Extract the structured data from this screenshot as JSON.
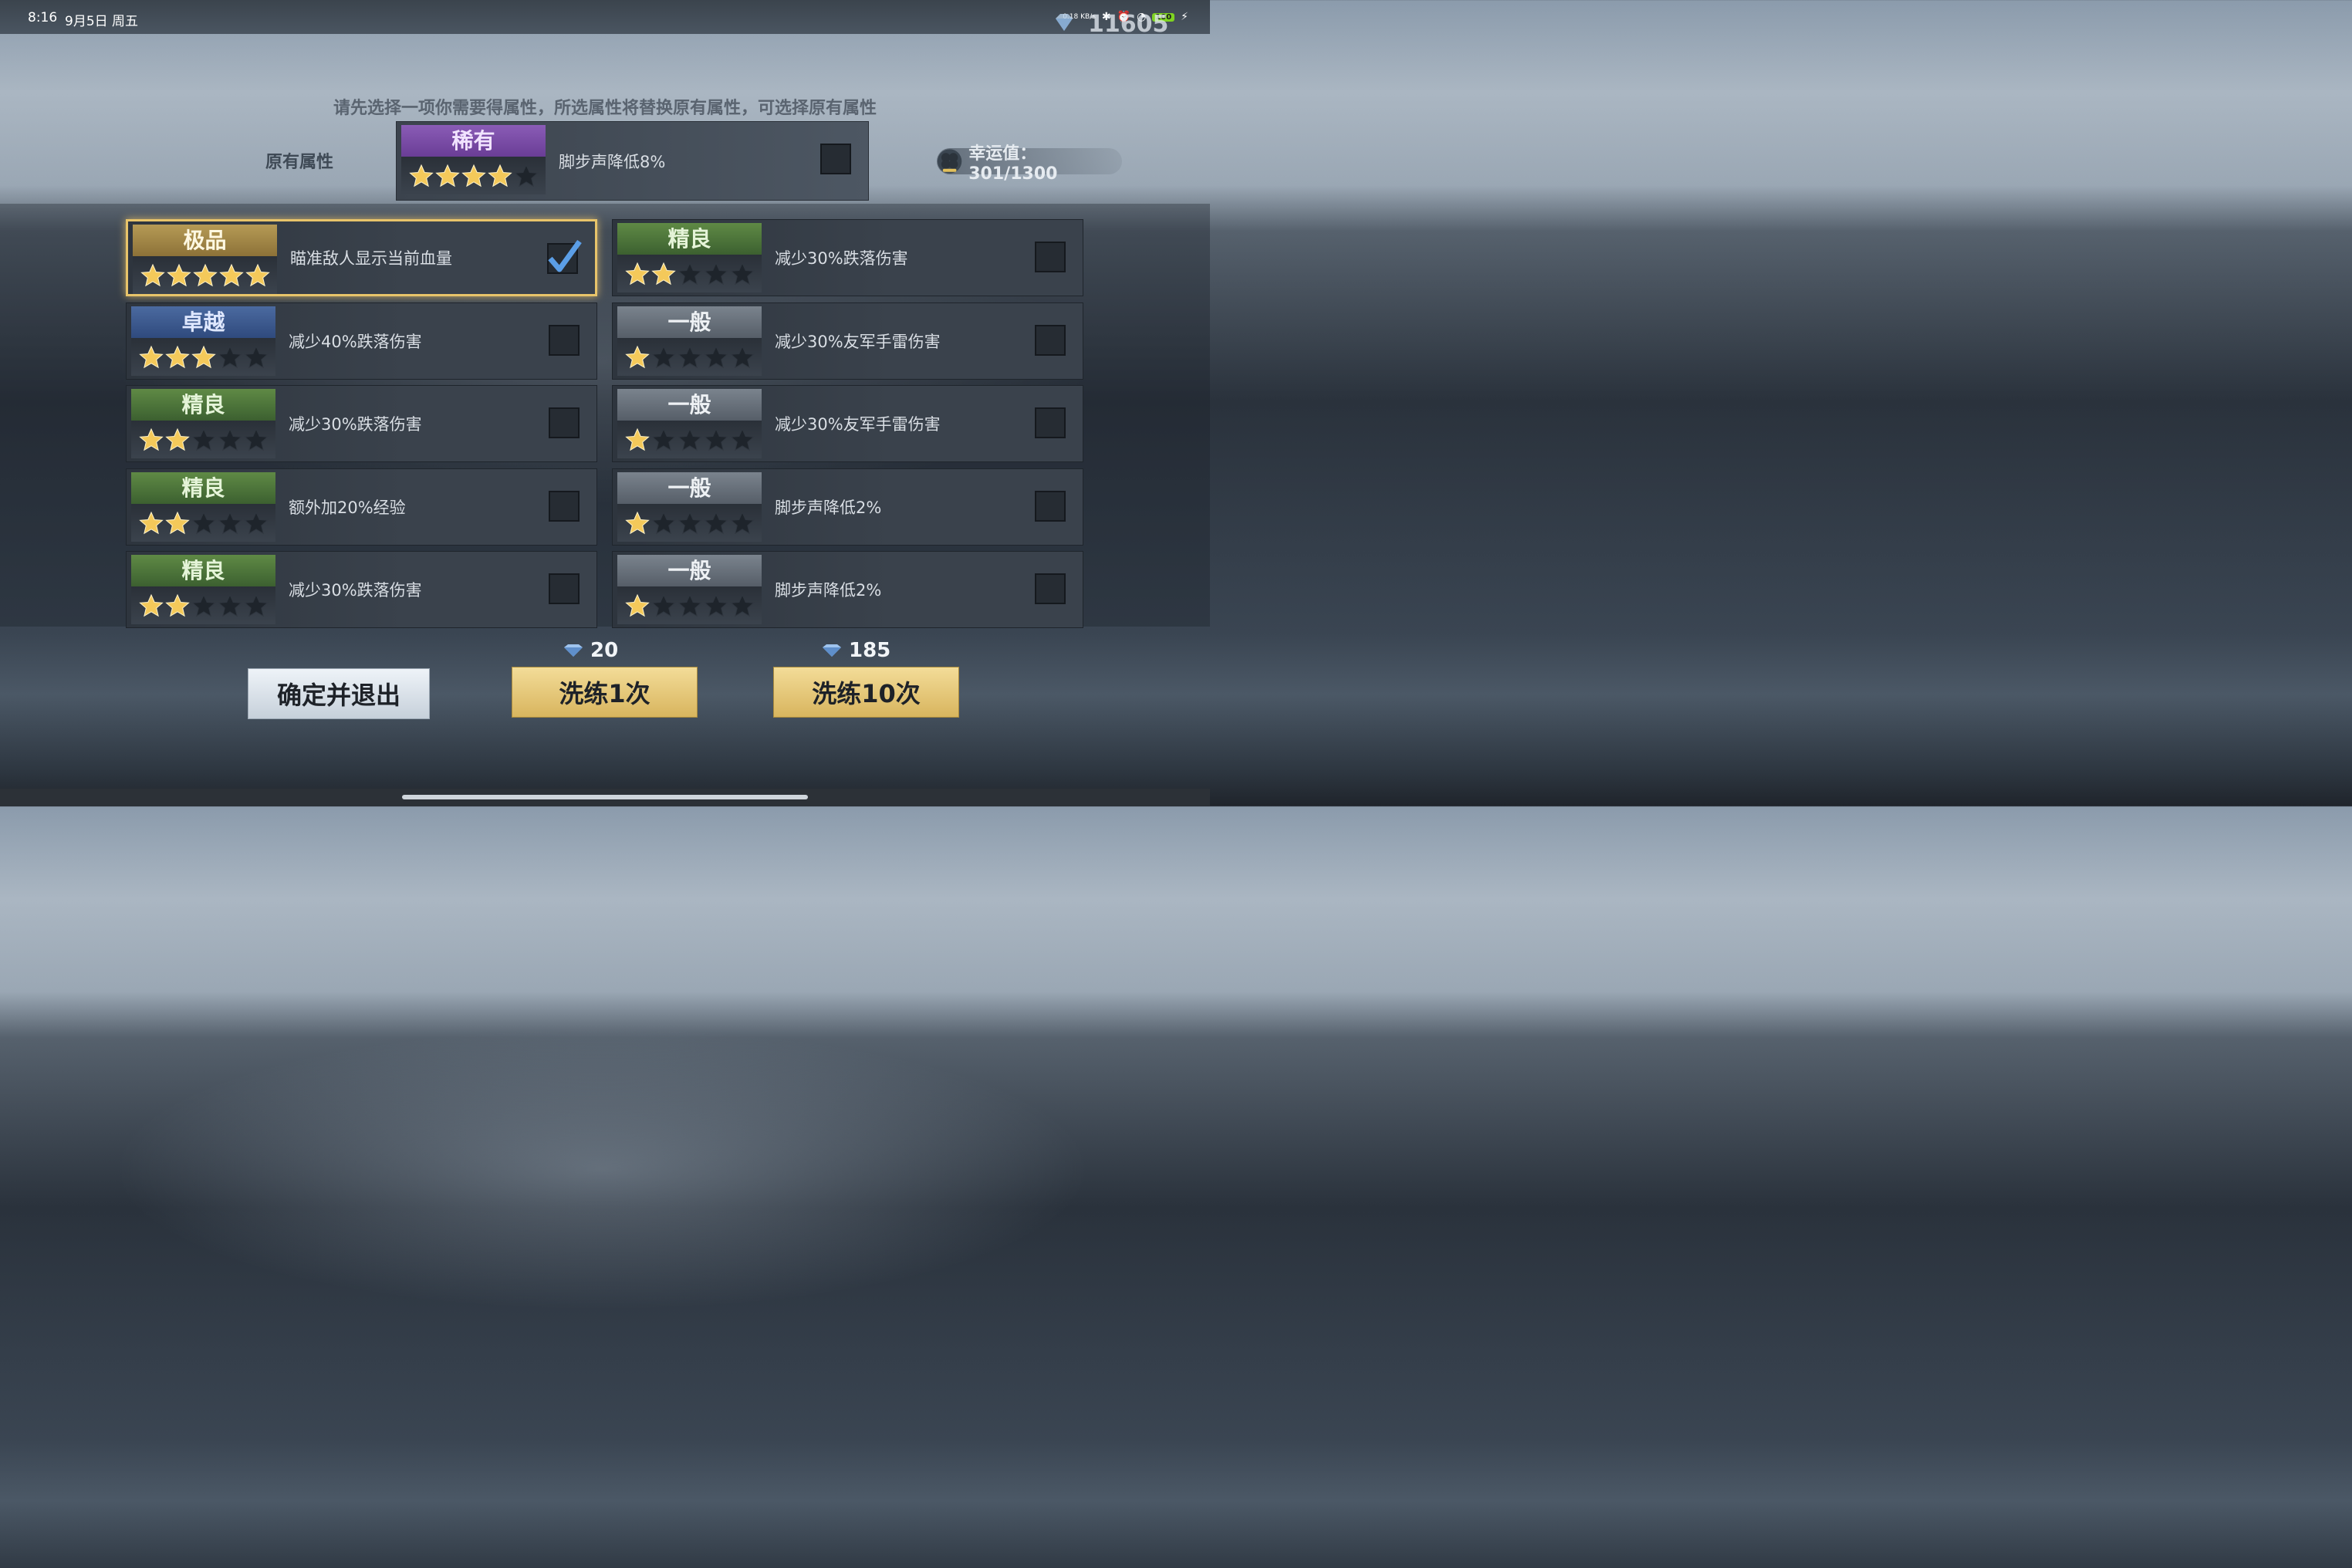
{
  "status_bar": {
    "time": "8:16",
    "date": "9月5日 周五",
    "net_speed": "0.18 KB/s",
    "battery": "100"
  },
  "currency": {
    "diamonds": "11605"
  },
  "instruction": "请先选择一项你需要得属性，所选属性将替换原有属性，可选择原有属性",
  "original": {
    "label": "原有属性",
    "tier": "稀有",
    "stars": 4,
    "text": "脚步声降低8%"
  },
  "luck": {
    "text": "幸运值：301/1300"
  },
  "options": [
    {
      "tier": "极品",
      "tier_key": "jipin",
      "stars": 5,
      "text": "瞄准敌人显示当前血量",
      "checked": true
    },
    {
      "tier": "精良",
      "tier_key": "jingliang",
      "stars": 2,
      "text": "减少30%跌落伤害",
      "checked": false
    },
    {
      "tier": "卓越",
      "tier_key": "zhuoyue",
      "stars": 3,
      "text": "减少40%跌落伤害",
      "checked": false
    },
    {
      "tier": "一般",
      "tier_key": "yiban",
      "stars": 1,
      "text": "减少30%友军手雷伤害",
      "checked": false
    },
    {
      "tier": "精良",
      "tier_key": "jingliang",
      "stars": 2,
      "text": "减少30%跌落伤害",
      "checked": false
    },
    {
      "tier": "一般",
      "tier_key": "yiban",
      "stars": 1,
      "text": "减少30%友军手雷伤害",
      "checked": false
    },
    {
      "tier": "精良",
      "tier_key": "jingliang",
      "stars": 2,
      "text": "额外加20%经验",
      "checked": false
    },
    {
      "tier": "一般",
      "tier_key": "yiban",
      "stars": 1,
      "text": "脚步声降低2%",
      "checked": false
    },
    {
      "tier": "精良",
      "tier_key": "jingliang",
      "stars": 2,
      "text": "减少30%跌落伤害",
      "checked": false
    },
    {
      "tier": "一般",
      "tier_key": "yiban",
      "stars": 1,
      "text": "脚步声降低2%",
      "checked": false
    }
  ],
  "buttons": {
    "confirm": "确定并退出",
    "wash_once": "洗练1次",
    "wash_once_cost": "20",
    "wash_ten": "洗练10次",
    "wash_ten_cost": "185"
  },
  "colors": {
    "gold": "#f4c95a",
    "selected_border": "#e8c46a",
    "tier_jipin": "#b69a55",
    "tier_zhuoyue": "#4b6aa0",
    "tier_jingliang": "#5f8a45",
    "tier_yiban": "#7a838d",
    "tier_xiyou": "#8a5cb6"
  }
}
